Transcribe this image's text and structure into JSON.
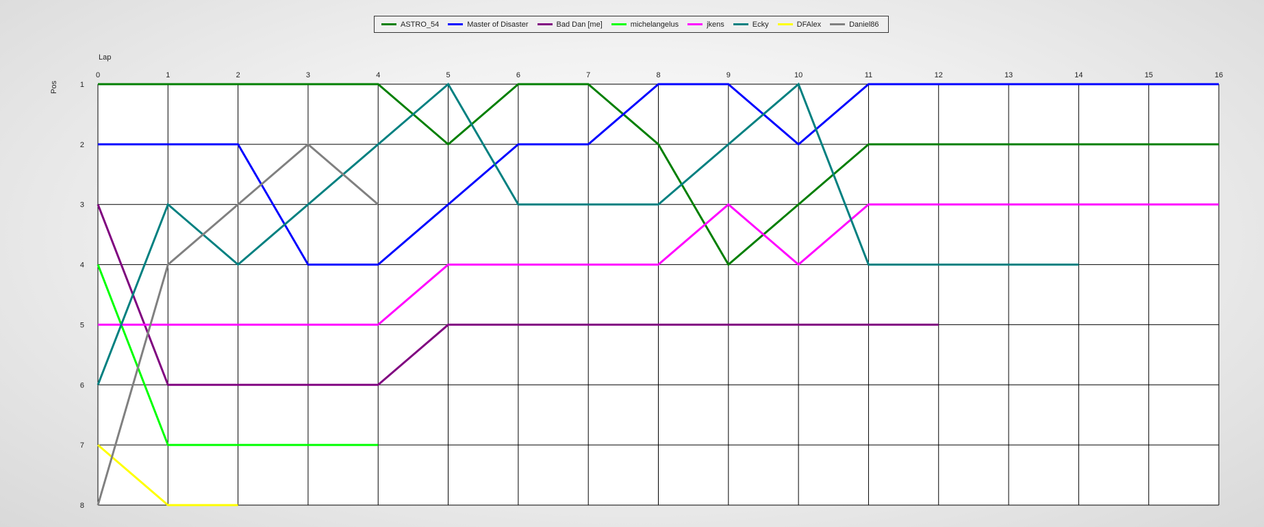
{
  "chart_data": {
    "type": "line",
    "xlabel": "Lap",
    "ylabel": "Pos",
    "x": [
      0,
      1,
      2,
      3,
      4,
      5,
      6,
      7,
      8,
      9,
      10,
      11,
      12,
      13,
      14,
      15,
      16
    ],
    "xlim": [
      0,
      16
    ],
    "ylim": [
      1,
      8
    ],
    "y_inverted": true,
    "x_tick_labels": [
      "0",
      "1",
      "2",
      "3",
      "4",
      "5",
      "6",
      "7",
      "8",
      "9",
      "10",
      "11",
      "12",
      "13",
      "14",
      "15",
      "16"
    ],
    "y_tick_labels": [
      "1",
      "2",
      "3",
      "4",
      "5",
      "6",
      "7",
      "8"
    ],
    "grid": true,
    "legend_position": "top-center",
    "series": [
      {
        "name": "ASTRO_54",
        "color": "#007f00",
        "values": [
          1,
          1,
          1,
          1,
          1,
          2,
          1,
          1,
          2,
          4,
          3,
          2,
          2,
          2,
          2,
          2,
          2
        ]
      },
      {
        "name": "Master of Disaster",
        "color": "#0000ff",
        "values": [
          2,
          2,
          2,
          4,
          4,
          3,
          2,
          2,
          1,
          1,
          2,
          1,
          1,
          1,
          1,
          1,
          1
        ]
      },
      {
        "name": "Bad Dan [me]",
        "color": "#800080",
        "values": [
          3,
          6,
          6,
          6,
          6,
          5,
          5,
          5,
          5,
          5,
          5,
          5,
          5
        ]
      },
      {
        "name": "michelangelus",
        "color": "#00ff00",
        "values": [
          4,
          7,
          7,
          7,
          7
        ]
      },
      {
        "name": "jkens",
        "color": "#ff00ff",
        "values": [
          5,
          5,
          5,
          5,
          5,
          4,
          4,
          4,
          4,
          3,
          4,
          3,
          3,
          3,
          3,
          3,
          3
        ]
      },
      {
        "name": "Ecky",
        "color": "#008080",
        "values": [
          6,
          3,
          4,
          3,
          2,
          1,
          3,
          3,
          3,
          2,
          1,
          4,
          4,
          4,
          4
        ]
      },
      {
        "name": "DFAlex",
        "color": "#ffff00",
        "values": [
          7,
          8,
          8
        ]
      },
      {
        "name": "Daniel86",
        "color": "#808080",
        "values": [
          8,
          4,
          3,
          2,
          3
        ]
      }
    ]
  }
}
